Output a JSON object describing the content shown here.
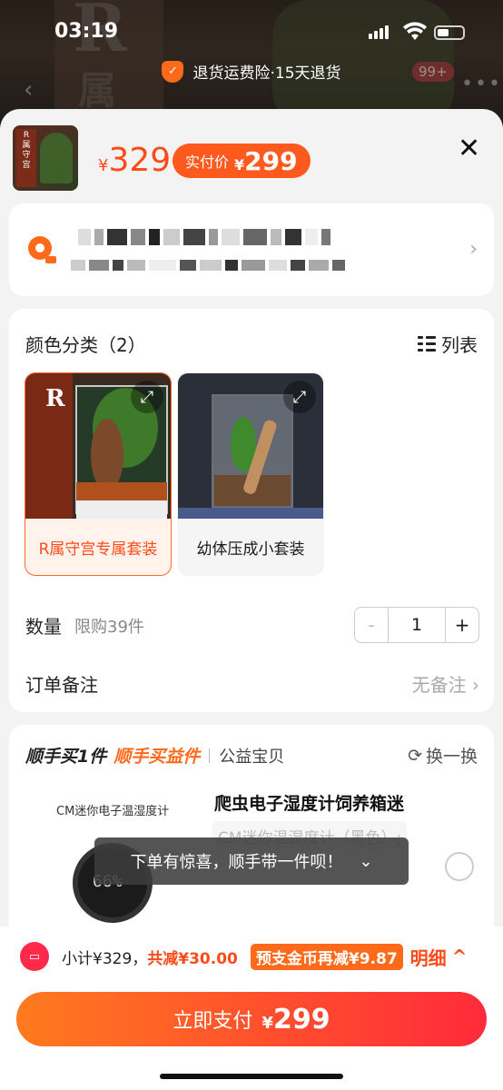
{
  "status": {
    "time": "03:19"
  },
  "insurance_banner": "退货运费险·15天退货",
  "header": {
    "price_currency": "¥",
    "price": "329",
    "paid_label": "实付价",
    "paid_currency": "¥",
    "paid_price": "299"
  },
  "options": {
    "title": "颜色分类（2）",
    "list_label": "列表",
    "skus": [
      {
        "label": "R属守宫专属套装",
        "selected": true
      },
      {
        "label": "幼体压成小套装",
        "selected": false
      }
    ],
    "qty_label": "数量",
    "qty_limit": "限购39件",
    "qty_value": "1",
    "note_label": "订单备注",
    "note_value": "无备注"
  },
  "addon": {
    "title_1": "顺手买1件",
    "title_2": "顺手买益件",
    "title_3": "公益宝贝",
    "swap_label": "换一换",
    "product_small": "CM迷你电子温湿度计",
    "product_name": "爬虫电子湿度计饲养箱迷",
    "product_spec": "CM迷你温湿度计（黑色）;"
  },
  "toast": "下单有惊喜，顺手带一件呗！",
  "footer": {
    "subtotal": "小计¥329，",
    "discount": "共减¥30.00",
    "coin": "预支金币再减¥9.87",
    "detail_label": "明细",
    "pay_label": "立即支付",
    "pay_currency": "¥",
    "pay_amount": "299"
  },
  "colors": {
    "accent": "#ff5a1e",
    "price": "#ff4a1a"
  }
}
